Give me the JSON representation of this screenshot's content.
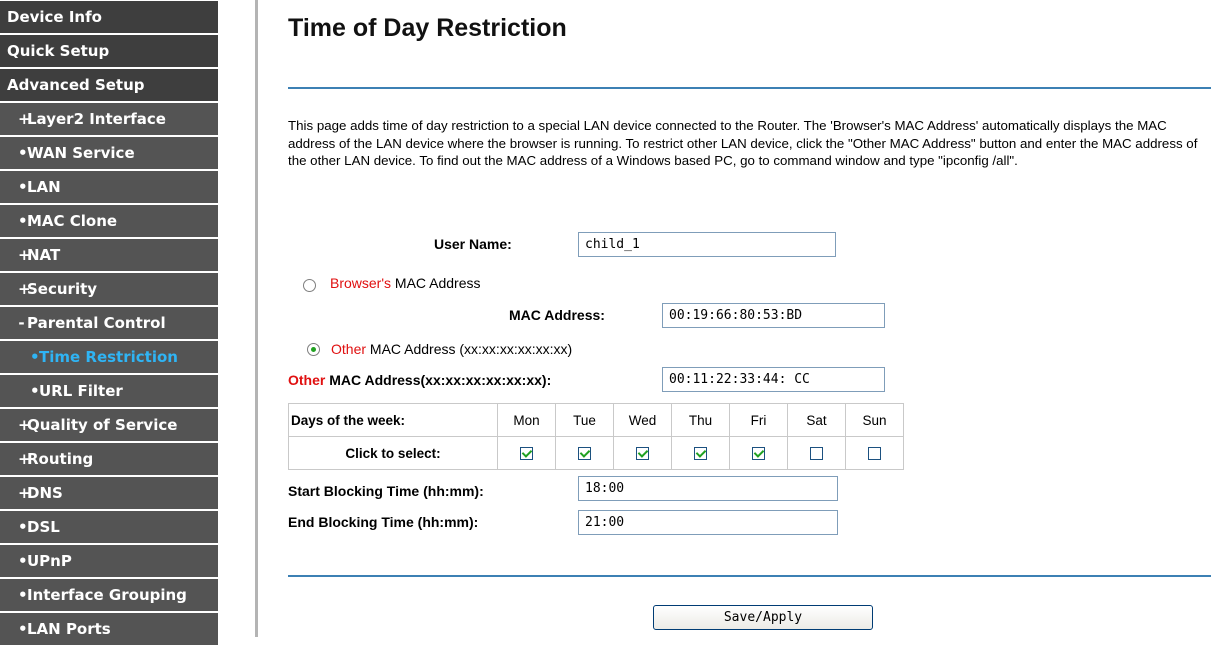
{
  "sidebar": {
    "items": [
      {
        "label": "Device Info",
        "level": 0,
        "mark": ""
      },
      {
        "label": "Quick Setup",
        "level": 0,
        "mark": ""
      },
      {
        "label": "Advanced Setup",
        "level": 0,
        "mark": ""
      },
      {
        "label": "Layer2 Interface",
        "level": 1,
        "mark": "+"
      },
      {
        "label": "WAN Service",
        "level": 1,
        "mark": "•"
      },
      {
        "label": "LAN",
        "level": 1,
        "mark": "•"
      },
      {
        "label": "MAC Clone",
        "level": 1,
        "mark": "•"
      },
      {
        "label": "NAT",
        "level": 1,
        "mark": "+"
      },
      {
        "label": "Security",
        "level": 1,
        "mark": "+"
      },
      {
        "label": "Parental Control",
        "level": 1,
        "mark": "-"
      },
      {
        "label": "Time Restriction",
        "level": 2,
        "mark": "•",
        "active": true
      },
      {
        "label": "URL Filter",
        "level": 2,
        "mark": "•"
      },
      {
        "label": "Quality of Service",
        "level": 1,
        "mark": "+"
      },
      {
        "label": "Routing",
        "level": 1,
        "mark": "+"
      },
      {
        "label": "DNS",
        "level": 1,
        "mark": "+"
      },
      {
        "label": "DSL",
        "level": 1,
        "mark": "•"
      },
      {
        "label": "UPnP",
        "level": 1,
        "mark": "•"
      },
      {
        "label": "Interface Grouping",
        "level": 1,
        "mark": "•"
      },
      {
        "label": "LAN Ports",
        "level": 1,
        "mark": "•"
      }
    ],
    "active_color": "#2fb4f4"
  },
  "main": {
    "title": "Time of Day Restriction",
    "intro": "This page adds time of day restriction to a special LAN device connected to the Router. The 'Browser's MAC Address' automatically displays the MAC address of the LAN device where the browser is running. To restrict other LAN device, click the \"Other MAC Address\" button and enter the MAC address of the other LAN device. To find out the MAC address of a Windows based PC, go to command window and type \"ipconfig /all\".",
    "user_name_label": "User Name:",
    "user_name_value": "child_1",
    "browser_mac_red": "Browser's",
    "browser_mac_rest": " MAC Address",
    "browser_mac_selected": false,
    "mac_address_label": "MAC Address:",
    "mac_address_value": "00:19:66:80:53:BD",
    "other_mac_red": "Other",
    "other_mac_rest": " MAC Address (xx:xx:xx:xx:xx:xx)",
    "other_mac_selected": true,
    "other_mac_field_red": "Other",
    "other_mac_field_rest": " MAC Address(xx:xx:xx:xx:xx:xx):",
    "other_mac_value": "00:11:22:33:44: CC",
    "days_label": "Days of the week:",
    "click_label": "Click to select:",
    "days": [
      {
        "name": "Mon",
        "checked": true
      },
      {
        "name": "Tue",
        "checked": true
      },
      {
        "name": "Wed",
        "checked": true
      },
      {
        "name": "Thu",
        "checked": true
      },
      {
        "name": "Fri",
        "checked": true
      },
      {
        "name": "Sat",
        "checked": false
      },
      {
        "name": "Sun",
        "checked": false
      }
    ],
    "start_label": "Start Blocking Time (hh:mm):",
    "start_value": "18:00",
    "end_label": "End Blocking Time (hh:mm):",
    "end_value": "21:00",
    "save_label": "Save/Apply"
  },
  "colors": {
    "nav_header": "#3e3e3e",
    "nav_sub": "#545454",
    "divider_line": "#3c80b4",
    "warning_red": "#e01010"
  }
}
